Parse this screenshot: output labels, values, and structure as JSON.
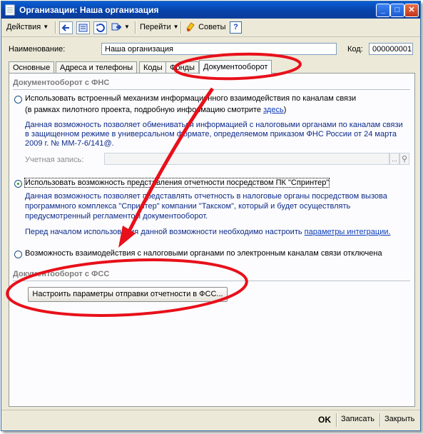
{
  "window": {
    "title": "Организации: Наша организация"
  },
  "toolbar": {
    "actions_label": "Действия",
    "goto_label": "Перейти",
    "tips_label": "Советы",
    "help_label": "?"
  },
  "header": {
    "name_label": "Наименование:",
    "name_value": "Наша организация",
    "code_label": "Код:",
    "code_value": "000000001"
  },
  "tabs": [
    {
      "label": "Основные"
    },
    {
      "label": "Адреса и телефоны"
    },
    {
      "label": "Коды"
    },
    {
      "label": "Фонды"
    },
    {
      "label": "Документооборот"
    }
  ],
  "fns": {
    "section_title": "Документооборот с ФНС",
    "opt1_label": "Использовать встроенный механизм информационного взаимодействия по каналам связи",
    "opt1_sub": "(в рамках пилотного проекта, подробную информацию смотрите",
    "opt1_link": "здесь",
    "opt1_sub_end": ")",
    "opt1_desc": [
      "Данная возможность позволяет обмениваться информацией с налоговыми органами по каналам связи",
      "в защищенном режиме в универсальном формате, определяемом приказом ФНС России от 24 марта",
      "2009 г. № ММ-7-6/141@."
    ],
    "account_label": "Учетная запись:",
    "account_dots": "...",
    "opt2_label": "Использовать возможность представления отчетности посредством ПК \"Спринтер\"",
    "opt2_desc": [
      "Данная возможность позволяет представлять отчетность в налоговые органы посредством вызова",
      "программного комплекса \"Спринтер\" компании \"Такском\", который и будет осуществлять",
      "предусмотренный регламентом документооборот."
    ],
    "opt2_note": "Перед началом использования данной возможности необходимо настроить",
    "opt2_link": "параметры интеграции.",
    "opt3_label": "Возможность взаимодействия с налоговыми органами по электронным каналам связи отключена",
    "selected_option": 2
  },
  "fss": {
    "section_title": "Документооборот с ФСС",
    "settings_button": "Настроить параметры отправки отчетности в ФСС..."
  },
  "footer": {
    "ok_label": "OK",
    "save_label": "Записать",
    "close_label": "Закрыть"
  },
  "colors": {
    "annotation": "#e8101a",
    "titlebar": "#0842a8",
    "description_text": "#0c2a88"
  }
}
